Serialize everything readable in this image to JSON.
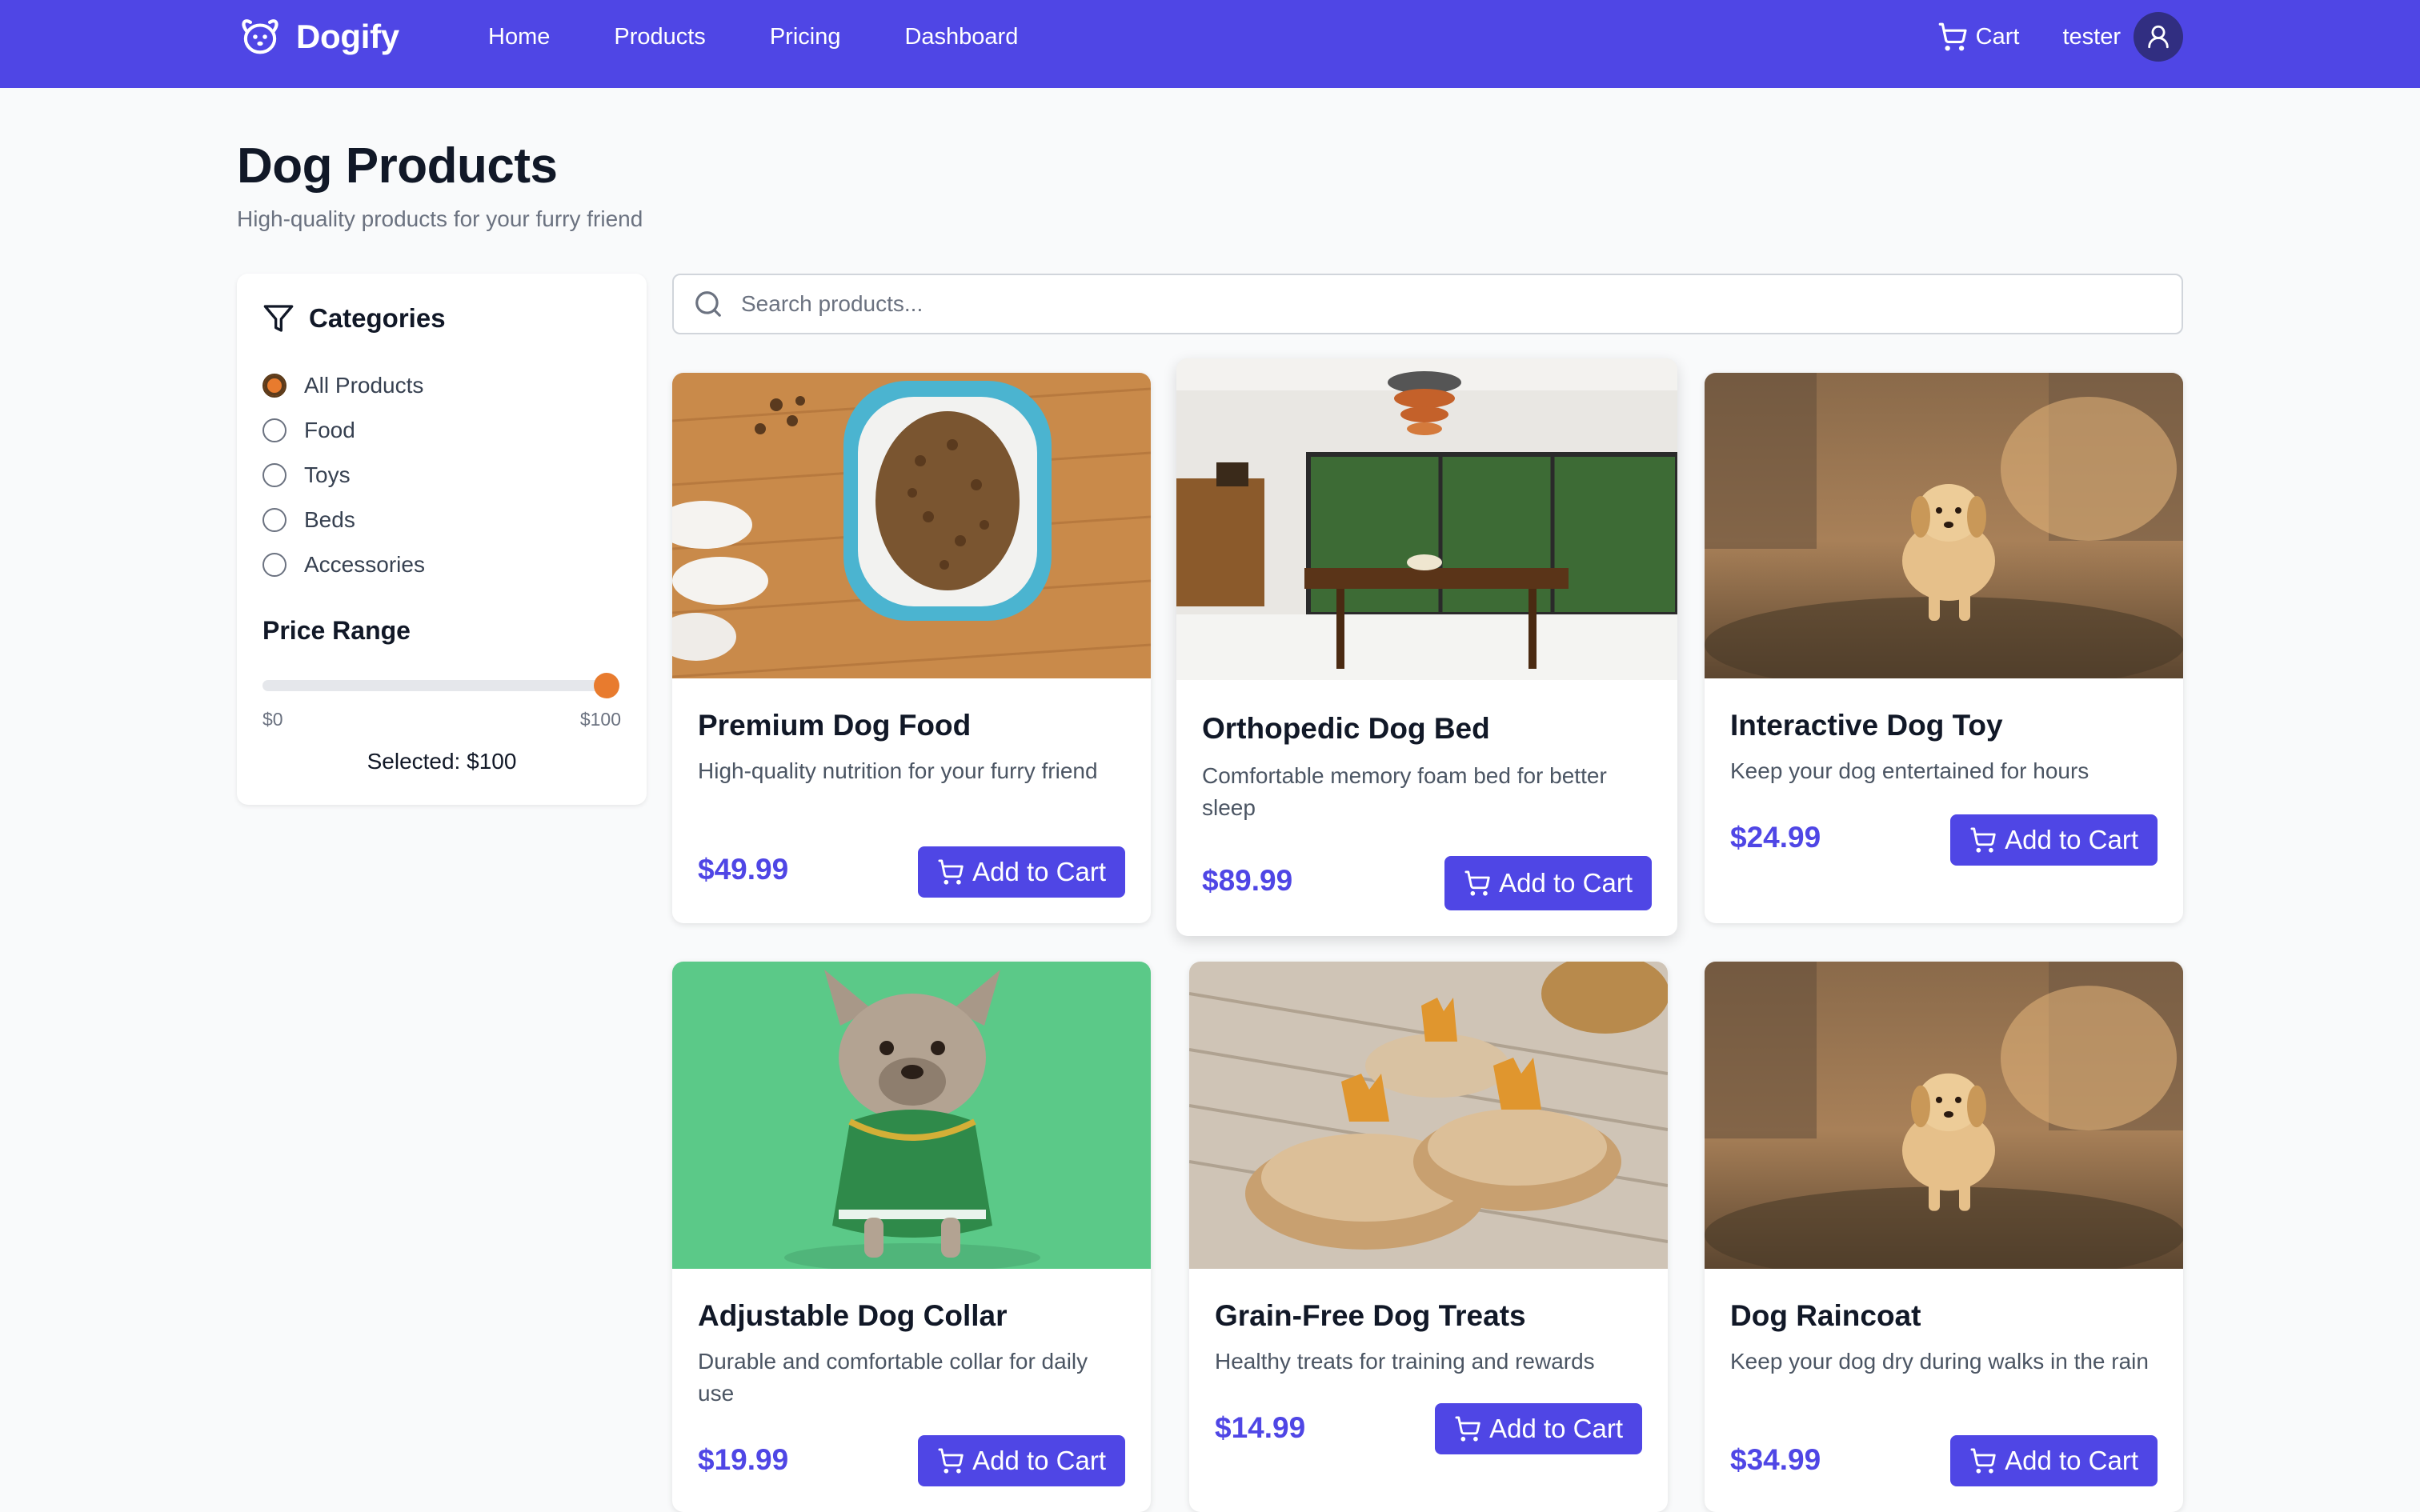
{
  "nav": {
    "brand": "Dogify",
    "links": [
      "Home",
      "Products",
      "Pricing",
      "Dashboard"
    ],
    "cart_label": "Cart",
    "username": "tester",
    "icons": {
      "logo": "dog-face-icon",
      "cart": "cart-icon",
      "user": "user-icon"
    },
    "color": "#4f46e5"
  },
  "header": {
    "title": "Dog Products",
    "subtitle": "High-quality products for your furry friend"
  },
  "sidebar": {
    "categories_title": "Categories",
    "categories": [
      "All Products",
      "Food",
      "Toys",
      "Beds",
      "Accessories"
    ],
    "selected_category": "All Products",
    "price_title": "Price Range",
    "price_min": "$0",
    "price_max": "$100",
    "price_value": 100,
    "price_selected": "Selected: $100",
    "accent": "#e87b2e"
  },
  "search": {
    "placeholder": "Search products..."
  },
  "products": [
    {
      "title": "Premium Dog Food",
      "description": "High-quality nutrition for your furry friend",
      "price": "$49.99",
      "button": "Add to Cart",
      "image": "dog-food-bowl-photo"
    },
    {
      "title": "Orthopedic Dog Bed",
      "description": "Comfortable memory foam bed for better sleep",
      "price": "$89.99",
      "button": "Add to Cart",
      "image": "dining-room-photo"
    },
    {
      "title": "Interactive Dog Toy",
      "description": "Keep your dog entertained for hours",
      "price": "$24.99",
      "button": "Add to Cart",
      "image": "puppy-running-photo"
    },
    {
      "title": "Adjustable Dog Collar",
      "description": "Durable and comfortable collar for daily use",
      "price": "$19.99",
      "button": "Add to Cart",
      "image": "french-bulldog-green-photo"
    },
    {
      "title": "Grain-Free Dog Treats",
      "description": "Healthy treats for training and rewards",
      "price": "$14.99",
      "button": "Add to Cart",
      "image": "dog-treats-photo"
    },
    {
      "title": "Dog Raincoat",
      "description": "Keep your dog dry during walks in the rain",
      "price": "$34.99",
      "button": "Add to Cart",
      "image": "puppy-running-photo"
    }
  ]
}
